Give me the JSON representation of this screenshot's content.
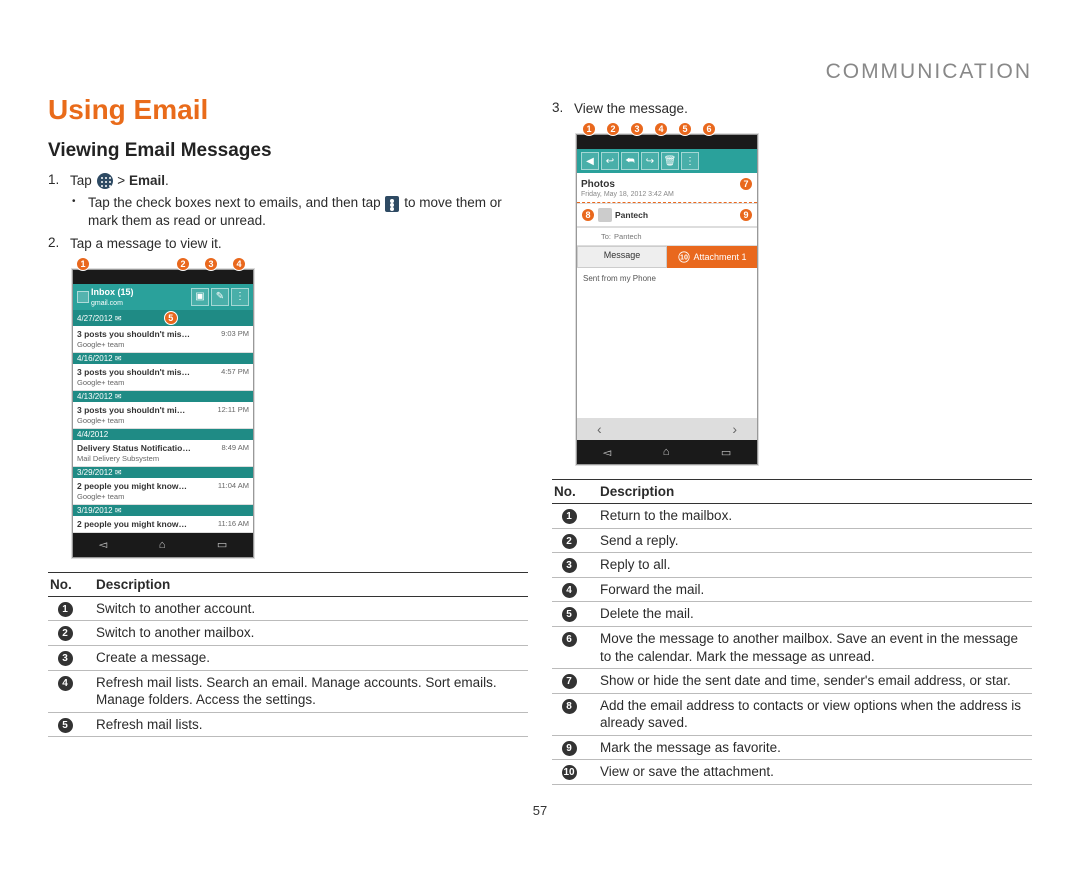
{
  "header": {
    "category": "COMMUNICATION"
  },
  "title": "Using Email",
  "subtitle": "Viewing Email Messages",
  "step1": {
    "num": "1.",
    "prefix": "Tap",
    "suffix_bold": "Email",
    "bullet_a": "Tap the check boxes next to emails, and then tap",
    "bullet_b": "to move them or mark them as read or unread."
  },
  "step2": {
    "num": "2.",
    "text": "Tap a message to view it."
  },
  "step3": {
    "num": "3.",
    "text": "View the message."
  },
  "phone1": {
    "title": "Inbox (15)",
    "sub": "gmail.com",
    "dates": [
      "4/27/2012 ✉",
      "4/16/2012 ✉",
      "4/13/2012 ✉",
      "4/4/2012",
      "3/29/2012 ✉",
      "3/19/2012 ✉"
    ],
    "rows": [
      {
        "s": "3 posts you shouldn't mis…",
        "t": "9:03 PM",
        "f": "Google+ team"
      },
      {
        "s": "3 posts you shouldn't mis…",
        "t": "4:57 PM",
        "f": "Google+ team"
      },
      {
        "s": "3 posts you shouldn't mi…",
        "t": "12:11 PM",
        "f": "Google+ team"
      },
      {
        "s": "Delivery Status Notificatio…",
        "t": "8:49 AM",
        "f": "Mail Delivery Subsystem"
      },
      {
        "s": "2 people you might know…",
        "t": "11:04 AM",
        "f": "Google+ team"
      },
      {
        "s": "2 people you might know…",
        "t": "11:16 AM",
        "f": ""
      }
    ]
  },
  "phone2": {
    "subject": "Photos",
    "time": "Friday, May 18, 2012 3:42 AM",
    "from": "Pantech",
    "to": "Pantech",
    "tab1": "Message",
    "tab2": "Attachment 1",
    "body": "Sent from my Phone"
  },
  "legend1": {
    "h1": "No.",
    "h2": "Description",
    "rows": [
      {
        "n": "1",
        "d": "Switch to another account."
      },
      {
        "n": "2",
        "d": "Switch to another mailbox."
      },
      {
        "n": "3",
        "d": "Create a message."
      },
      {
        "n": "4",
        "d": "Refresh mail lists. Search an email. Manage accounts. Sort emails. Manage folders. Access the settings."
      },
      {
        "n": "5",
        "d": "Refresh mail lists."
      }
    ]
  },
  "legend2": {
    "h1": "No.",
    "h2": "Description",
    "rows": [
      {
        "n": "1",
        "d": "Return to the mailbox."
      },
      {
        "n": "2",
        "d": "Send a reply."
      },
      {
        "n": "3",
        "d": "Reply to all."
      },
      {
        "n": "4",
        "d": "Forward the mail."
      },
      {
        "n": "5",
        "d": "Delete the mail."
      },
      {
        "n": "6",
        "d": "Move the message to another mailbox. Save an event in the message to the calendar. Mark the message as unread."
      },
      {
        "n": "7",
        "d": "Show or hide the sent date and time, sender's email address, or star."
      },
      {
        "n": "8",
        "d": "Add the email address to contacts or view options when the address is already saved."
      },
      {
        "n": "9",
        "d": "Mark the message as favorite."
      },
      {
        "n": "10",
        "d": "View or save the attachment."
      }
    ]
  },
  "pagenum": "57"
}
